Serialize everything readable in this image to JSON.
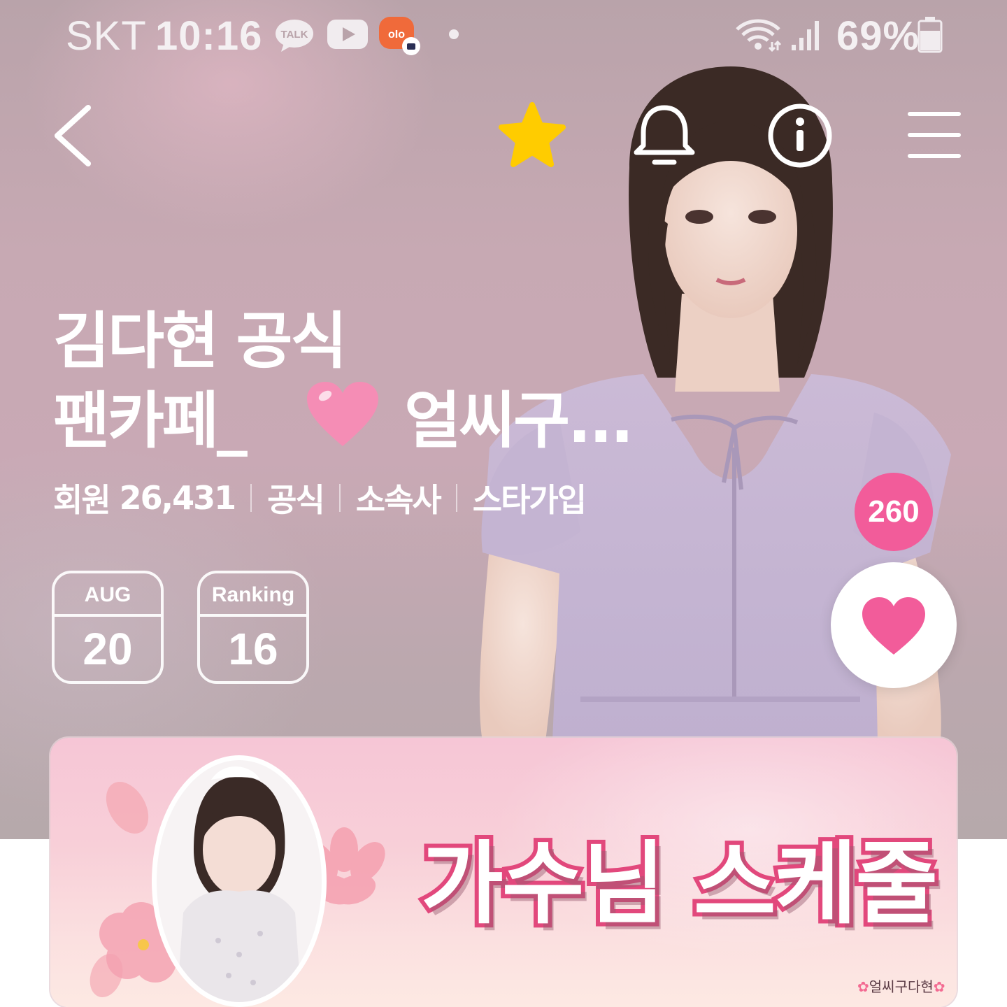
{
  "status_bar": {
    "carrier": "SKT",
    "time": "10:16",
    "talk_badge": "TALK",
    "battery_percent": "69%"
  },
  "nav": {
    "back_icon": "chevron-left-icon",
    "favorite_icon": "star-icon",
    "notification_icon": "bell-icon",
    "info_icon": "info-icon",
    "menu_icon": "hamburger-menu-icon",
    "favorite_color": "#FFCC00"
  },
  "cafe": {
    "title_line1": "김다현 공식",
    "title_line2_prefix": "팬카페_",
    "title_line2_suffix": "얼씨구...",
    "meta": {
      "members_label": "회원",
      "members_count": "26,431",
      "official": "공식",
      "agency": "소속사",
      "star_join": "스타가입"
    },
    "date_tile": {
      "month": "AUG",
      "day": "20"
    },
    "ranking_tile": {
      "label": "Ranking",
      "value": "16"
    },
    "like_count": "260",
    "accent_color": "#F25C9A"
  },
  "banner": {
    "title": "가수님 스케줄",
    "watermark": "얼씨구다현"
  }
}
